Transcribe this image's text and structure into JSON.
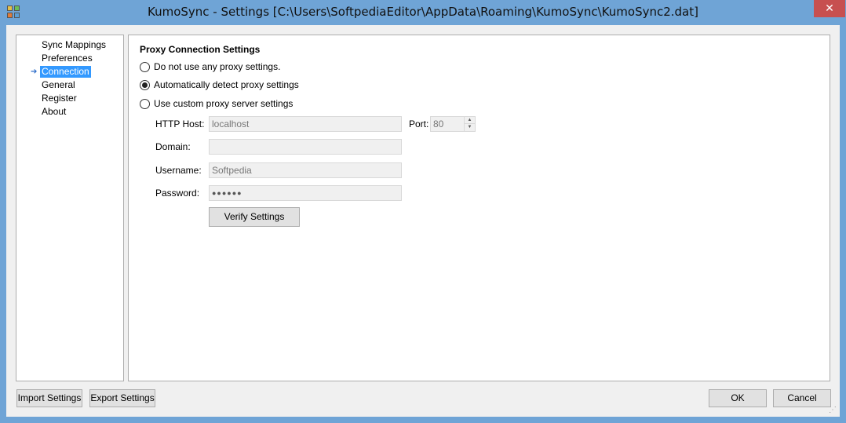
{
  "window": {
    "title": "KumoSync - Settings [C:\\Users\\SoftpediaEditor\\AppData\\Roaming\\KumoSync\\KumoSync2.dat]",
    "close_glyph": "✕"
  },
  "nav": {
    "items": [
      {
        "label": "Sync Mappings",
        "selected": false
      },
      {
        "label": "Preferences",
        "selected": false
      },
      {
        "label": "Connection",
        "selected": true
      },
      {
        "label": "General",
        "selected": false
      },
      {
        "label": "Register",
        "selected": false
      },
      {
        "label": "About",
        "selected": false
      }
    ],
    "arrow_glyph": "➔"
  },
  "proxy": {
    "section_title": "Proxy Connection Settings",
    "options": [
      {
        "label": "Do not use any proxy settings.",
        "checked": false
      },
      {
        "label": "Automatically detect proxy settings",
        "checked": true
      },
      {
        "label": "Use custom proxy server settings",
        "checked": false
      }
    ],
    "http_host_label": "HTTP Host:",
    "http_host_value": "localhost",
    "port_label": "Port:",
    "port_value": "80",
    "domain_label": "Domain:",
    "domain_value": "",
    "username_label": "Username:",
    "username_value": "Softpedia",
    "password_label": "Password:",
    "password_value": "●●●●●●",
    "verify_button": "Verify Settings"
  },
  "footer": {
    "import_button": "Import Settings",
    "export_button": "Export Settings",
    "ok_button": "OK",
    "cancel_button": "Cancel"
  }
}
